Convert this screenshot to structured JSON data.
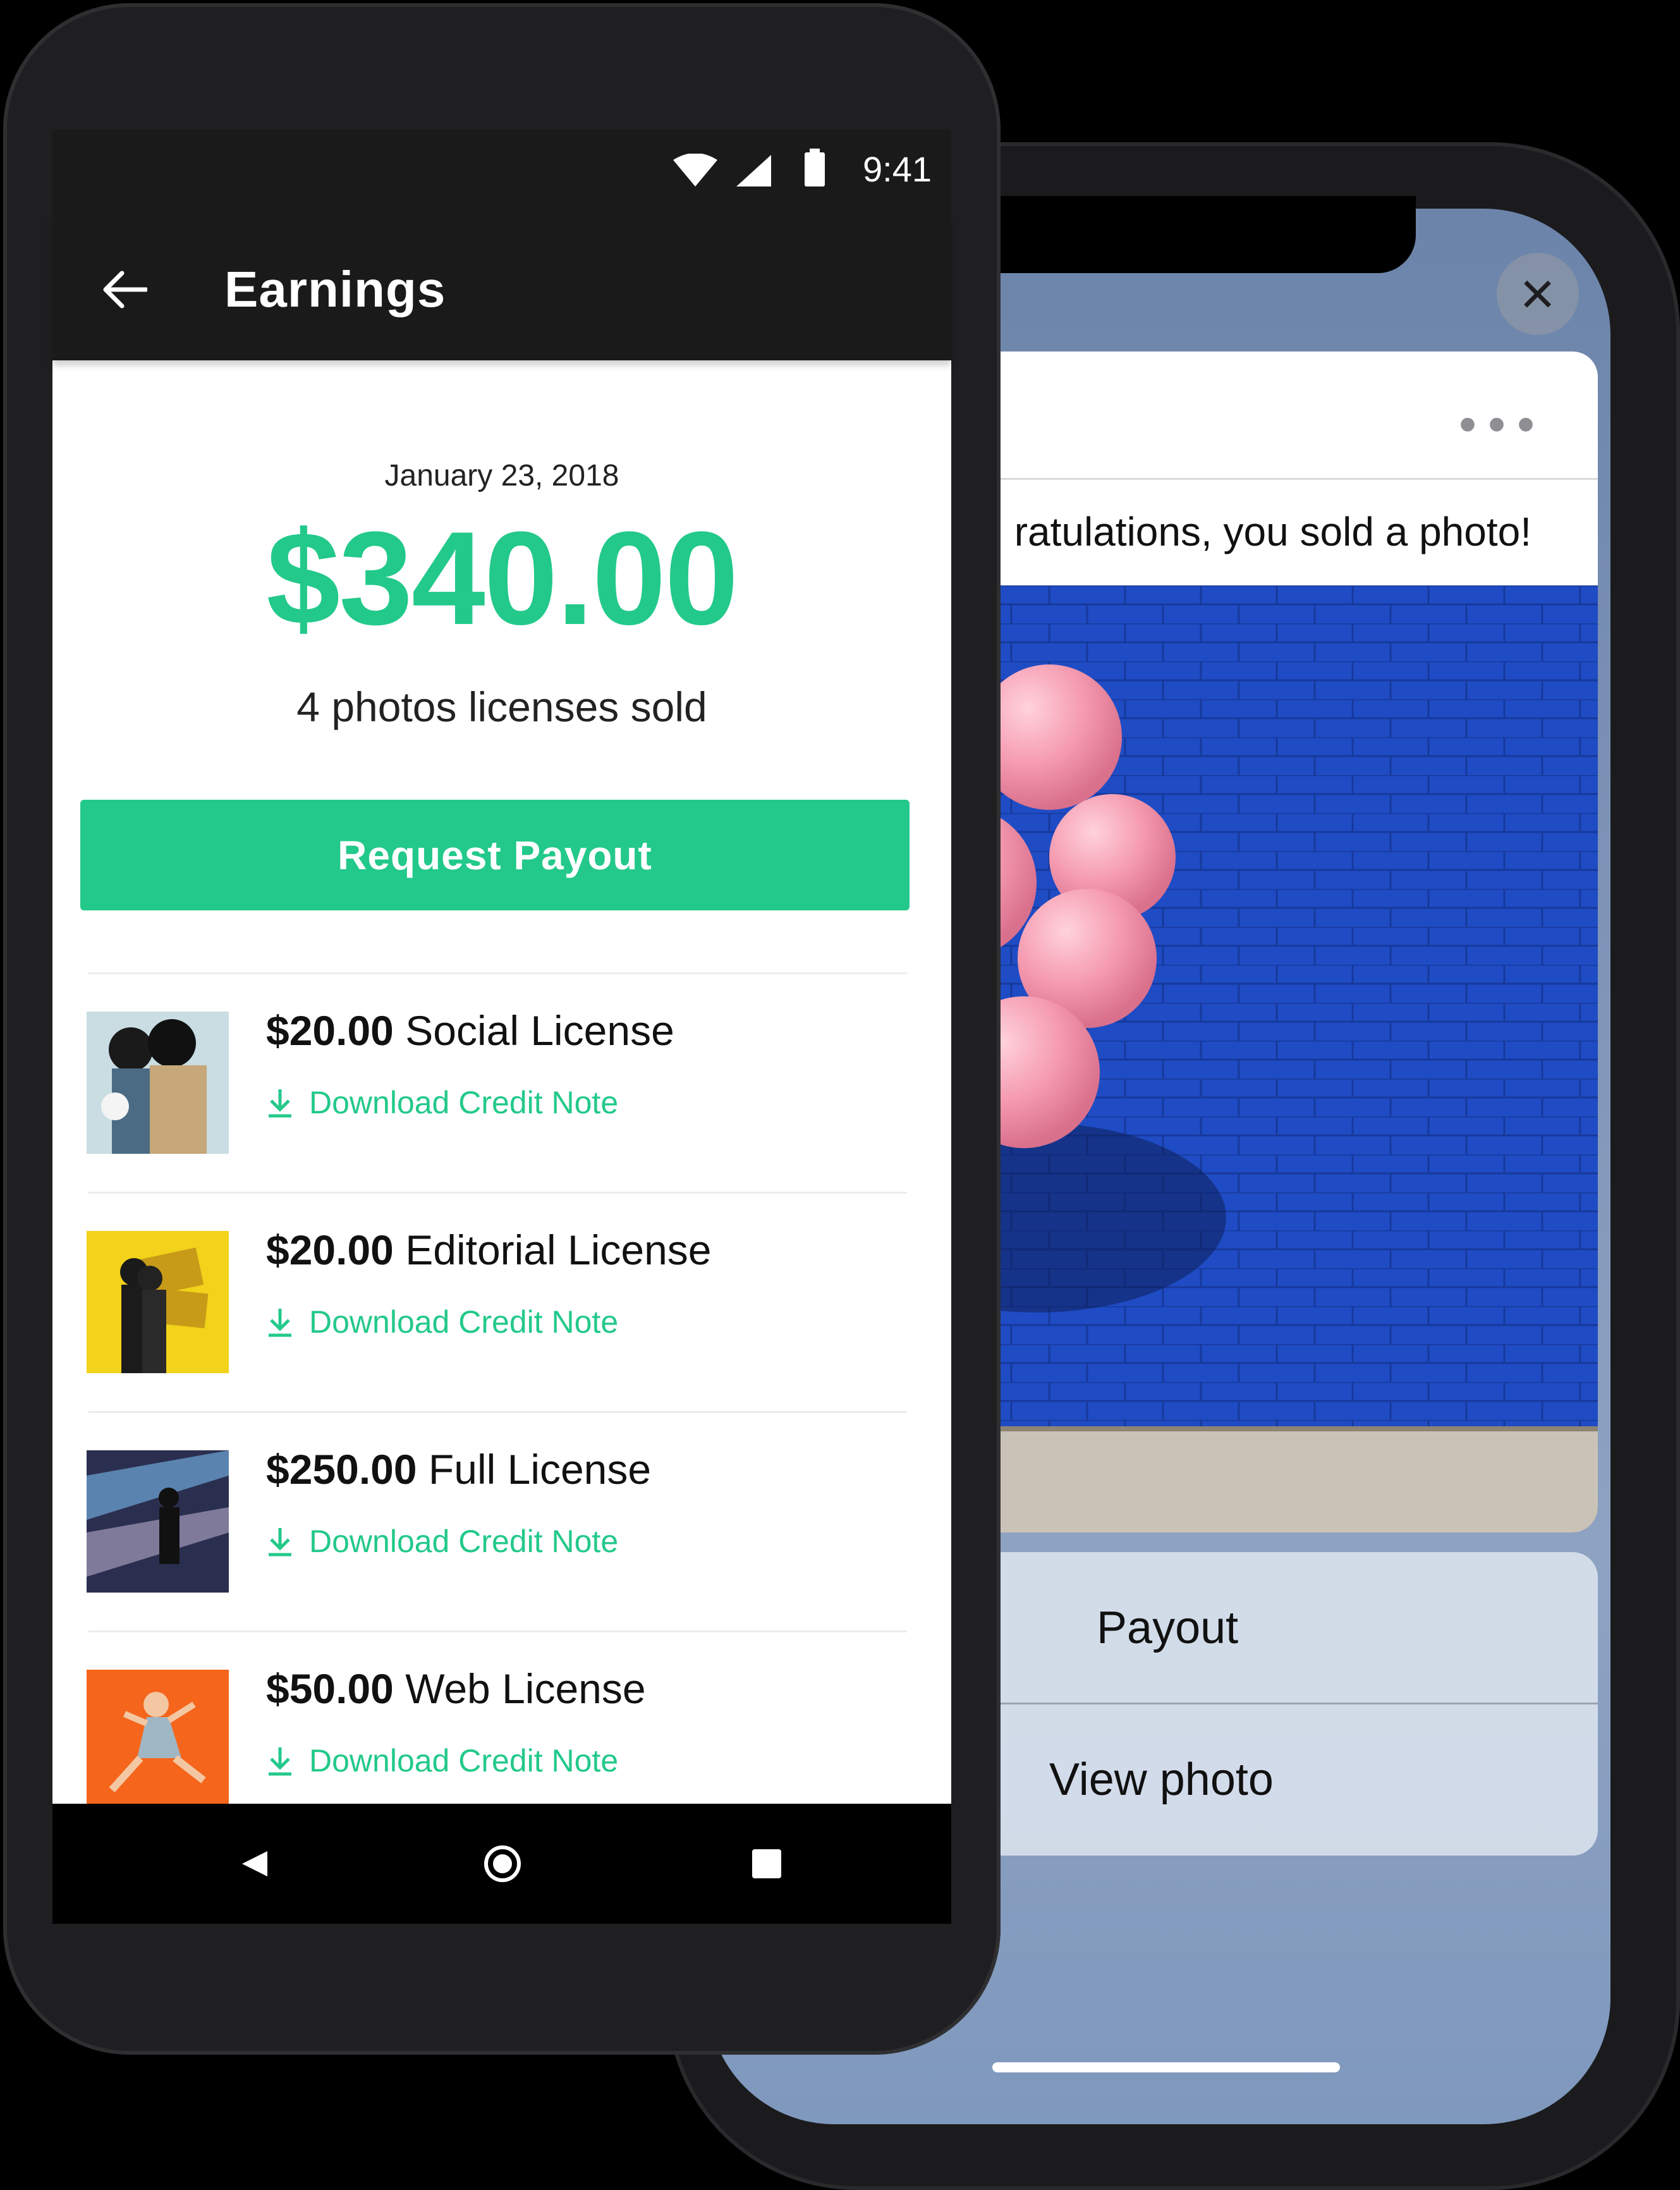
{
  "ios": {
    "close_icon": "close-icon",
    "more_icon": "more-dots-icon",
    "notification_message": "ratulations, you sold a photo!",
    "actions": [
      {
        "label": "Payout"
      },
      {
        "label": "View photo"
      }
    ]
  },
  "android": {
    "status": {
      "time": "9:41"
    },
    "app_bar": {
      "title": "Earnings"
    },
    "summary": {
      "date": "January 23, 2018",
      "amount": "$340.00",
      "sub": "4 photos licenses sold"
    },
    "payout_button": "Request Payout",
    "licenses": [
      {
        "price": "$20.00",
        "name": "Social License",
        "download": "Download Credit Note"
      },
      {
        "price": "$20.00",
        "name": "Editorial License",
        "download": "Download Credit Note"
      },
      {
        "price": "$250.00",
        "name": "Full License",
        "download": "Download Credit Note"
      },
      {
        "price": "$50.00",
        "name": "Web License",
        "download": "Download Credit Note"
      }
    ],
    "colors": {
      "accent": "#23c98a",
      "bar": "#1a1a1a"
    }
  }
}
